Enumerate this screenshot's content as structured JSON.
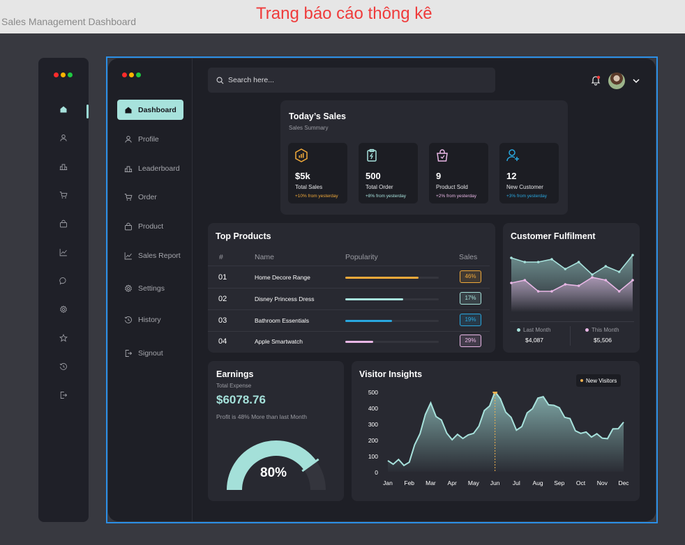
{
  "window": {
    "file_title": "Sales Management Dashboard",
    "heading": "Trang báo cáo thông kê"
  },
  "window_dots": [
    "#ff2b2b",
    "#ffb400",
    "#1fc941"
  ],
  "mini_sidebar": {
    "icons": [
      "home-icon",
      "user-icon",
      "leaderboard-icon",
      "cart-icon",
      "bag-icon",
      "chart-icon",
      "message-icon",
      "settings-icon",
      "star-icon",
      "history-icon",
      "signout-icon"
    ]
  },
  "sidebar": {
    "items": [
      {
        "label": "Dashboard",
        "icon": "home-icon"
      },
      {
        "label": "Profile",
        "icon": "user-icon"
      },
      {
        "label": "Leaderboard",
        "icon": "leaderboard-icon"
      },
      {
        "label": "Order",
        "icon": "cart-icon"
      },
      {
        "label": "Product",
        "icon": "bag-icon"
      },
      {
        "label": "Sales Report",
        "icon": "chart-icon"
      },
      {
        "label": "Settings",
        "icon": "settings-icon"
      },
      {
        "label": "History",
        "icon": "history-icon"
      },
      {
        "label": "Signout",
        "icon": "signout-icon"
      }
    ]
  },
  "header": {
    "search_placeholder": "Search here..."
  },
  "today_sales": {
    "title": "Today’s Sales",
    "subtitle": "Sales Summary",
    "stats": [
      {
        "value": "$5k",
        "label": "Total Sales",
        "change": "+10% from yesterday",
        "color": "#f0a93a"
      },
      {
        "value": "500",
        "label": "Total Order",
        "change": "+8% from yesterday",
        "color": "#a7e2dc"
      },
      {
        "value": "9",
        "label": "Product Sold",
        "change": "+2% from yesterday",
        "color": "#e9b7e6"
      },
      {
        "value": "12",
        "label": "New Customer",
        "change": "+3% from yesterday",
        "color": "#29a8e0"
      }
    ]
  },
  "top_products": {
    "title": "Top Products",
    "columns": [
      "#",
      "Name",
      "Popularity",
      "Sales"
    ],
    "rows": [
      {
        "num": "01",
        "name": "Home Decore Range",
        "popularity": 0.78,
        "sales": "46%",
        "color": "#f0a93a"
      },
      {
        "num": "02",
        "name": "Disney Princess Dress",
        "popularity": 0.62,
        "sales": "17%",
        "color": "#a7e2dc"
      },
      {
        "num": "03",
        "name": "Bathroom Essentials",
        "popularity": 0.5,
        "sales": "19%",
        "color": "#29a8e0"
      },
      {
        "num": "04",
        "name": "Apple Smartwatch",
        "popularity": 0.3,
        "sales": "29%",
        "color": "#e9b7e6"
      }
    ]
  },
  "fulfilment": {
    "title": "Customer Fulfilment",
    "legend": [
      {
        "label": "Last Month",
        "value": "$4,087",
        "color": "#a7e2dc"
      },
      {
        "label": "This Month",
        "value": "$5,506",
        "color": "#e9b7e6"
      }
    ]
  },
  "earnings": {
    "title": "Earnings",
    "subtitle": "Total Expense",
    "amount": "$6078.76",
    "note": "Profit is 48% More than last Month",
    "percent_label": "80%",
    "percent": 0.8
  },
  "chart_data": [
    {
      "type": "area",
      "title": "Visitor Insights",
      "x": [
        "Jan",
        "Feb",
        "Mar",
        "Apr",
        "May",
        "Jun",
        "Jul",
        "Aug",
        "Sep",
        "Oct",
        "Nov",
        "Dec"
      ],
      "ylim": [
        0,
        500
      ],
      "yticks": [
        0,
        100,
        200,
        300,
        400,
        500
      ],
      "legend": "New Visitors",
      "legend_color": "#f0b04e",
      "highlight_index": 5,
      "series": [
        {
          "name": "New Visitors",
          "values": [
            70,
            60,
            430,
            200,
            240,
            500,
            260,
            460,
            400,
            240,
            210,
            310
          ]
        }
      ]
    },
    {
      "type": "area",
      "title": "Customer Fulfilment",
      "series": [
        {
          "name": "Last Month",
          "values": [
            0.9,
            0.75,
            0.75,
            0.85,
            0.5,
            0.75,
            0.3,
            0.6,
            0.4,
            1.0
          ]
        },
        {
          "name": "This Month",
          "values": [
            0.5,
            0.6,
            0.2,
            0.2,
            0.45,
            0.4,
            0.7,
            0.6,
            0.2,
            0.6
          ]
        }
      ]
    }
  ]
}
